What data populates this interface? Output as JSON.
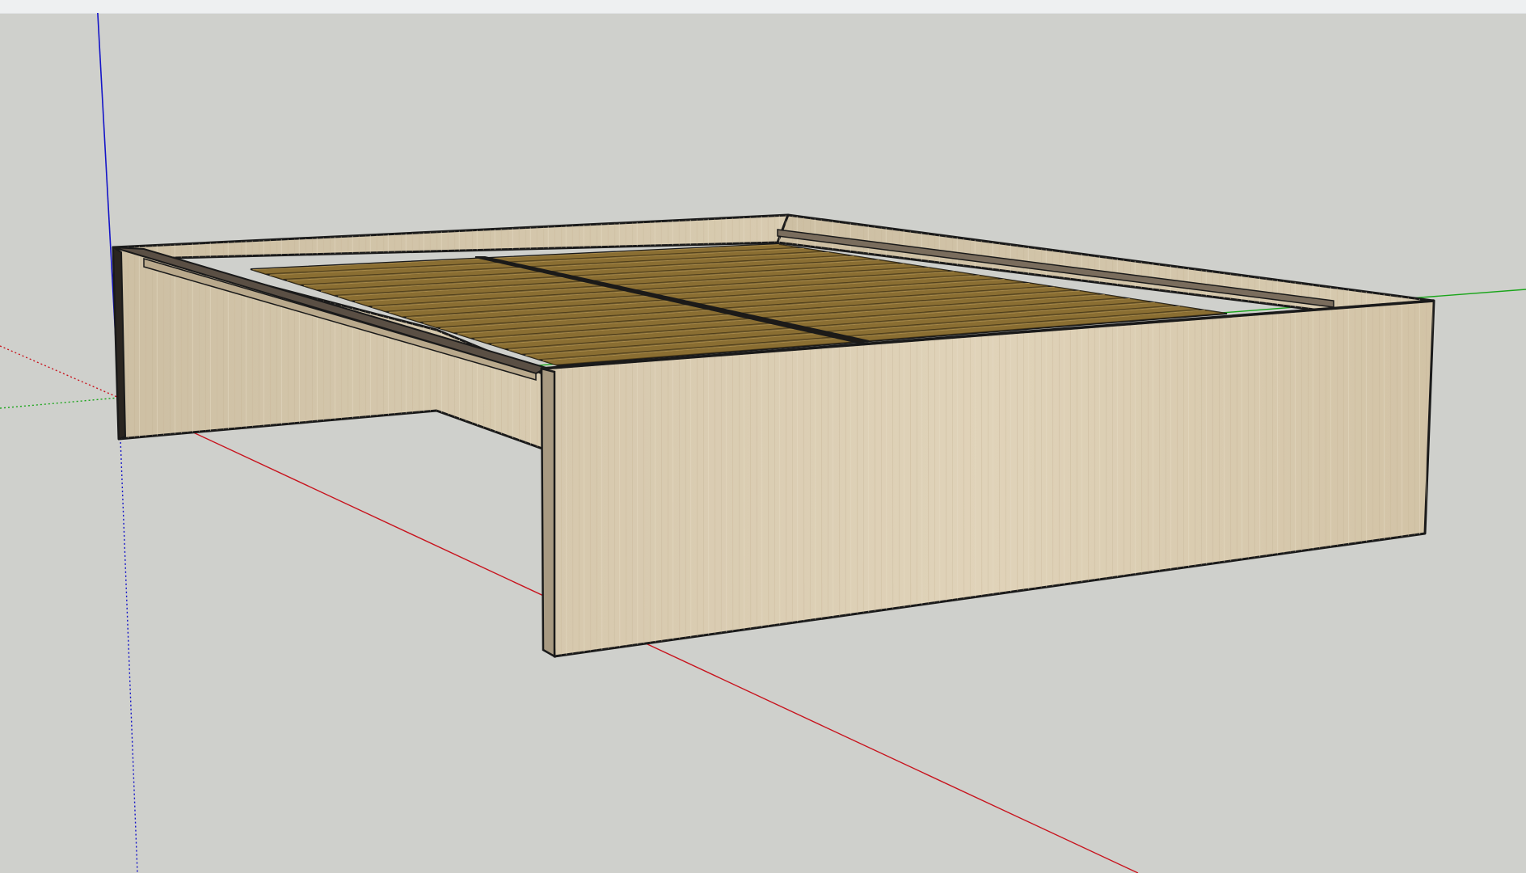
{
  "app": {
    "type": "3d-modeling-viewport"
  },
  "viewport": {
    "background_color": "#cfd0cc",
    "toolbar_strip_color": "#eef0f1"
  },
  "axes": {
    "red_axis_color": "#c8141e",
    "green_axis_color": "#1aa51a",
    "blue_axis_color": "#1414c8"
  },
  "model": {
    "object": "bed frame",
    "panel_color": "#dccfb4",
    "slat_color": "#8a6e32",
    "edge_color": "#1a1a1a",
    "slat_count": 18
  }
}
